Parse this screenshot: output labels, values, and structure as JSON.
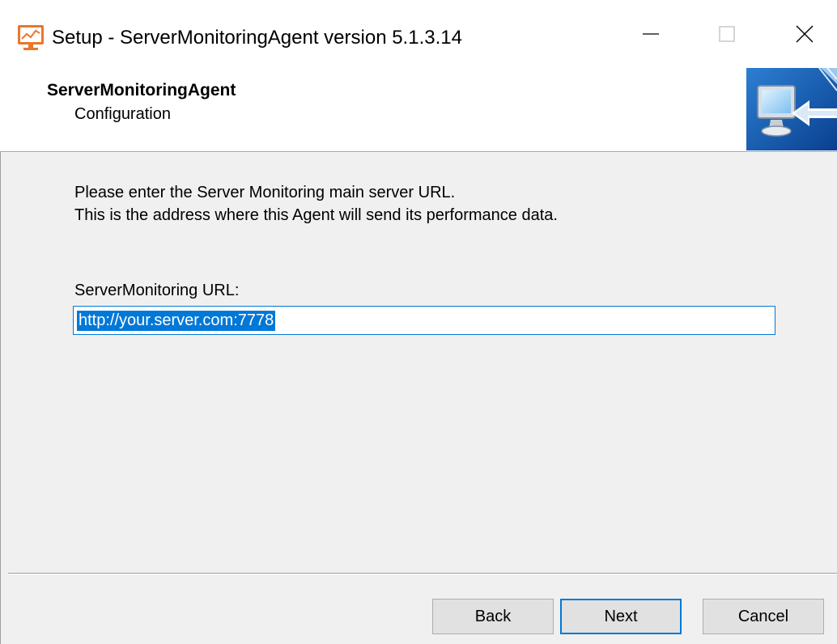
{
  "window": {
    "title": "Setup - ServerMonitoringAgent version 5.1.3.14",
    "controls": {
      "minimize_icon": "minimize-icon",
      "maximize_icon": "maximize-icon",
      "close_icon": "close-icon"
    },
    "app_icon": "monitor-chart-icon"
  },
  "header": {
    "title": "ServerMonitoringAgent",
    "subtitle": "Configuration",
    "image_icon": "monitor-arrow-icon"
  },
  "body": {
    "intro_line1": "Please enter the Server Monitoring main server URL.",
    "intro_line2": "This is the address where this Agent will send its performance data.",
    "url_label": "ServerMonitoring URL:",
    "url_value": "http://your.server.com:7778"
  },
  "footer": {
    "back_label": "Back",
    "next_label": "Next",
    "cancel_label": "Cancel"
  },
  "colors": {
    "accent": "#0078d7",
    "panel": "#f0f0f0",
    "button": "#e1e1e1",
    "app_icon": "#e8772e"
  }
}
